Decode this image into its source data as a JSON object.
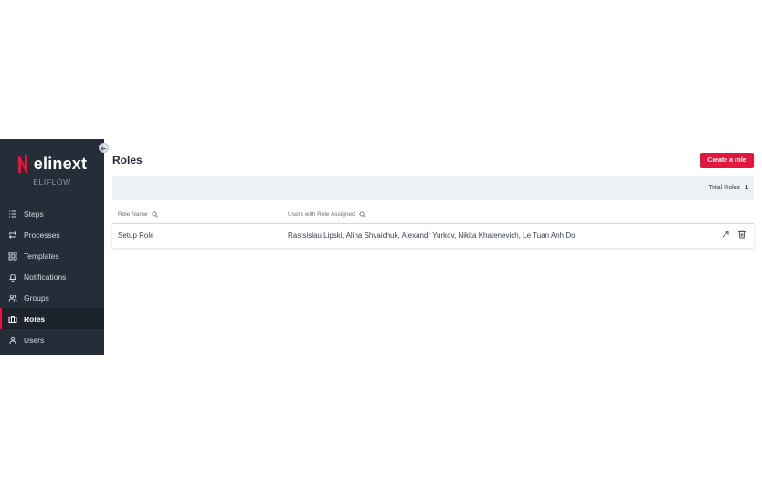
{
  "brand": {
    "logo_text": "elinext",
    "app_name": "ELIFLOW",
    "accent": "#e3173e",
    "sidebar_bg": "#252d38"
  },
  "sidebar": {
    "items": [
      {
        "label": "Steps",
        "icon": "list-icon",
        "active": false
      },
      {
        "label": "Processes",
        "icon": "repeat-icon",
        "active": false
      },
      {
        "label": "Templates",
        "icon": "grid-icon",
        "active": false
      },
      {
        "label": "Notifications",
        "icon": "bell-icon",
        "active": false
      },
      {
        "label": "Groups",
        "icon": "users-icon",
        "active": false
      },
      {
        "label": "Roles",
        "icon": "briefcase-icon",
        "active": true
      },
      {
        "label": "Users",
        "icon": "user-icon",
        "active": false
      }
    ]
  },
  "header": {
    "title": "Roles",
    "create_label": "Create a role"
  },
  "summary": {
    "label": "Total Roles",
    "count": "1"
  },
  "table": {
    "columns": [
      "Role Name",
      "Users with Role Assigned"
    ],
    "rows": [
      {
        "role": "Setup Role",
        "users": "Rastsislau Lipski, Alina Shvaichuk, Alexandr Yurkov, Nikita Khatenevich, Le Tuan Anh Do"
      }
    ]
  }
}
